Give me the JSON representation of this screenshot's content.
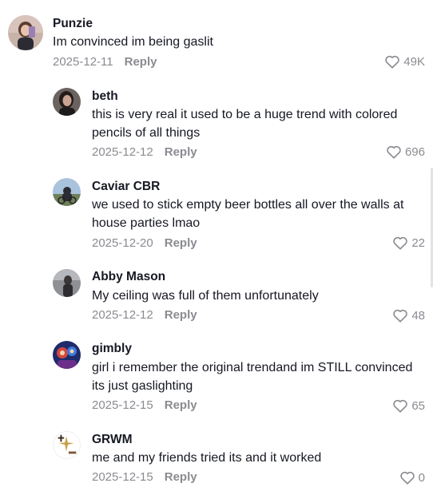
{
  "comments": [
    {
      "username": "Punzie",
      "text": "Im convinced im being gaslit",
      "date": "2025-12-11",
      "reply": "Reply",
      "likes": "49K",
      "avatar": "avatar-photo"
    },
    {
      "username": "beth",
      "text": "this is very real it used to be a huge trend with colored pencils of all things",
      "date": "2025-12-12",
      "reply": "Reply",
      "likes": "696",
      "avatar": "avatar-photo"
    },
    {
      "username": "Caviar CBR",
      "text": "we used to stick empty beer bottles all over the walls at house parties lmao",
      "date": "2025-12-20",
      "reply": "Reply",
      "likes": "22",
      "avatar": "avatar-photo"
    },
    {
      "username": "Abby Mason",
      "text": "My ceiling was full of them unfortunately",
      "date": "2025-12-12",
      "reply": "Reply",
      "likes": "48",
      "avatar": "avatar-photo"
    },
    {
      "username": "gimbly",
      "text": "girl i remember the original trendand im STILL convinced its just gaslighting",
      "date": "2025-12-15",
      "reply": "Reply",
      "likes": "65",
      "avatar": "avatar-photo"
    },
    {
      "username": "GRWM",
      "text": "me and my friends tried its and it worked",
      "date": "2025-12-15",
      "reply": "Reply",
      "likes": "0",
      "avatar": "avatar-logo"
    }
  ],
  "icons": {
    "like": "heart-outline-icon"
  },
  "colors": {
    "text": "#161823",
    "secondary": "#8a8b91",
    "background": "#ffffff"
  }
}
